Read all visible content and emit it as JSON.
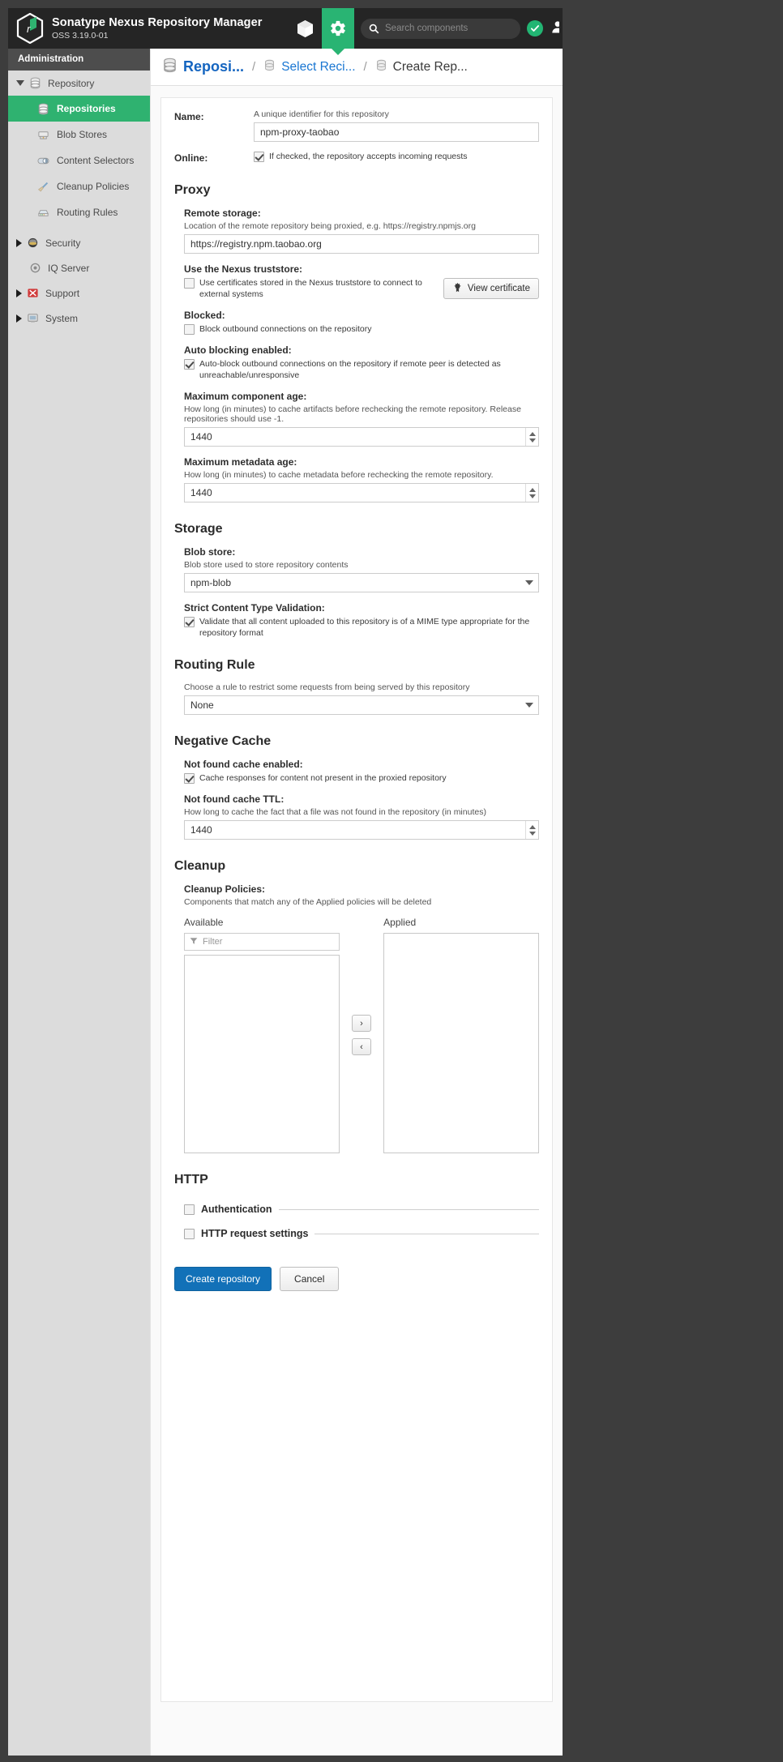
{
  "header": {
    "brand_title": "Sonatype Nexus Repository Manager",
    "brand_version": "OSS 3.19.0-01",
    "icons": [
      "cube-icon",
      "gear-icon",
      "health-check-icon",
      "user-icon"
    ],
    "search_placeholder": "Search components"
  },
  "sidebar": {
    "section_title": "Administration",
    "groups": [
      {
        "label": "Repository",
        "icon": "database-icon",
        "expanded": true,
        "items": [
          {
            "label": "Repositories",
            "icon": "repositories-icon",
            "selected": true
          },
          {
            "label": "Blob Stores",
            "icon": "blob-store-icon",
            "selected": false
          },
          {
            "label": "Content Selectors",
            "icon": "content-selector-icon",
            "selected": false
          },
          {
            "label": "Cleanup Policies",
            "icon": "broom-icon",
            "selected": false
          },
          {
            "label": "Routing Rules",
            "icon": "routing-rule-icon",
            "selected": false
          }
        ]
      },
      {
        "label": "Security",
        "icon": "shield-icon",
        "expanded": false,
        "items": []
      },
      {
        "label": "IQ Server",
        "icon": "iq-server-icon",
        "expanded": null,
        "items": []
      },
      {
        "label": "Support",
        "icon": "support-icon",
        "expanded": false,
        "items": []
      },
      {
        "label": "System",
        "icon": "system-icon",
        "expanded": false,
        "items": []
      }
    ]
  },
  "breadcrumb": {
    "item1": "Reposi...",
    "item2": "Select Reci...",
    "item3": "Create Rep...",
    "separator": "/"
  },
  "form": {
    "name": {
      "label": "Name:",
      "hint": "A unique identifier for this repository",
      "value": "npm-proxy-taobao"
    },
    "online": {
      "label": "Online:",
      "checkbox_text": "If checked, the repository accepts incoming requests",
      "checked": true
    },
    "proxy": {
      "title": "Proxy",
      "remote_storage": {
        "label": "Remote storage:",
        "hint": "Location of the remote repository being proxied, e.g. https://registry.npmjs.org",
        "value": "https://registry.npm.taobao.org"
      },
      "truststore": {
        "label": "Use the Nexus truststore:",
        "checkbox_text": "Use certificates stored in the Nexus truststore to connect to external systems",
        "checked": false,
        "button_label": "View certificate",
        "button_icon": "certificate-icon"
      },
      "blocked": {
        "label": "Blocked:",
        "checkbox_text": "Block outbound connections on the repository",
        "checked": false
      },
      "auto_blocking": {
        "label": "Auto blocking enabled:",
        "checkbox_text": "Auto-block outbound connections on the repository if remote peer is detected as unreachable/unresponsive",
        "checked": true
      },
      "max_component_age": {
        "label": "Maximum component age:",
        "hint": "How long (in minutes) to cache artifacts before rechecking the remote repository. Release repositories should use -1.",
        "value": "1440"
      },
      "max_metadata_age": {
        "label": "Maximum metadata age:",
        "hint": "How long (in minutes) to cache metadata before rechecking the remote repository.",
        "value": "1440"
      }
    },
    "storage": {
      "title": "Storage",
      "blob_store": {
        "label": "Blob store:",
        "hint": "Blob store used to store repository contents",
        "value": "npm-blob"
      },
      "strict_validation": {
        "label": "Strict Content Type Validation:",
        "checkbox_text": "Validate that all content uploaded to this repository is of a MIME type appropriate for the repository format",
        "checked": true
      }
    },
    "routing_rule": {
      "title": "Routing Rule",
      "hint": "Choose a rule to restrict some requests from being served by this repository",
      "value": "None"
    },
    "negative_cache": {
      "title": "Negative Cache",
      "not_found_enabled": {
        "label": "Not found cache enabled:",
        "checkbox_text": "Cache responses for content not present in the proxied repository",
        "checked": true
      },
      "not_found_ttl": {
        "label": "Not found cache TTL:",
        "hint": "How long to cache the fact that a file was not found in the repository (in minutes)",
        "value": "1440"
      }
    },
    "cleanup": {
      "title": "Cleanup",
      "policies_label": "Cleanup Policies:",
      "policies_hint": "Components that match any of the Applied policies will be deleted",
      "available_header": "Available",
      "applied_header": "Applied",
      "filter_placeholder": "Filter",
      "filter_icon": "filter-icon",
      "move_right": "›",
      "move_left": "‹",
      "available_items": [],
      "applied_items": []
    },
    "http": {
      "title": "HTTP",
      "authentication": {
        "label": "Authentication",
        "checked": false
      },
      "request_settings": {
        "label": "HTTP request settings",
        "checked": false
      }
    },
    "actions": {
      "submit": "Create repository",
      "cancel": "Cancel"
    }
  },
  "colors": {
    "accent_green": "#29b473",
    "link_blue": "#1976d2",
    "primary_button": "#1271b8",
    "header_bg": "#252525",
    "sidebar_bg": "#dcdcdc"
  }
}
